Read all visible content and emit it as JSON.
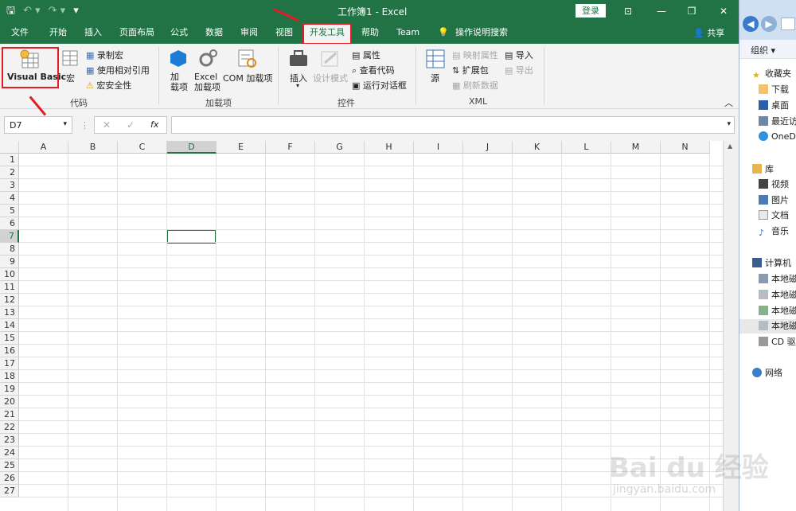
{
  "titlebar": {
    "title": "工作簿1  -  Excel",
    "login": "登录"
  },
  "tabs": [
    {
      "label": "文件"
    },
    {
      "label": "开始"
    },
    {
      "label": "插入"
    },
    {
      "label": "页面布局"
    },
    {
      "label": "公式"
    },
    {
      "label": "数据"
    },
    {
      "label": "审阅"
    },
    {
      "label": "视图"
    },
    {
      "label": "开发工具"
    },
    {
      "label": "帮助"
    },
    {
      "label": "Team"
    },
    {
      "label": "操作说明搜索"
    }
  ],
  "share": "共享",
  "ribbon": {
    "code": {
      "visual_basic": "Visual Basic",
      "macros": "宏",
      "record_macro": "录制宏",
      "relative_refs": "使用相对引用",
      "macro_security": "宏安全性",
      "group": "代码"
    },
    "addins": {
      "addins": "加\n载项",
      "excel_addins": "Excel\n加载项",
      "com_addins": "COM 加载项",
      "group": "加载项"
    },
    "controls": {
      "insert": "插入",
      "design_mode": "设计模式",
      "properties": "属性",
      "view_code": "查看代码",
      "run_dialog": "运行对话框",
      "group": "控件"
    },
    "xml": {
      "source": "源",
      "map_props": "映射属性",
      "expansion": "扩展包",
      "refresh": "刷新数据",
      "import": "导入",
      "export": "导出",
      "group": "XML"
    }
  },
  "formula": {
    "namebox": "D7",
    "fx": "fx",
    "value": ""
  },
  "columns": [
    "A",
    "B",
    "C",
    "D",
    "E",
    "F",
    "G",
    "H",
    "I",
    "J",
    "K",
    "L",
    "M",
    "N"
  ],
  "rows": [
    "1",
    "2",
    "3",
    "4",
    "5",
    "6",
    "7",
    "8",
    "9",
    "10",
    "11",
    "12",
    "13",
    "14",
    "15",
    "16",
    "17",
    "18",
    "19",
    "20",
    "21",
    "22",
    "23",
    "24",
    "25",
    "26",
    "27"
  ],
  "selected": {
    "column": "D",
    "row": "7"
  },
  "explorer": {
    "organize": "组织 ▾",
    "favorites": "收藏夹",
    "downloads": "下载",
    "desktop": "桌面",
    "recent": "最近访",
    "onedrive": "OneD",
    "libraries": "库",
    "videos": "视频",
    "pictures": "图片",
    "documents": "文档",
    "music": "音乐",
    "computer": "计算机",
    "disk1": "本地磁",
    "disk2": "本地磁",
    "disk3": "本地磁",
    "disk4": "本地磁",
    "cd": "CD 驱",
    "network": "网络"
  },
  "watermark": {
    "brand": "Bai du 经验",
    "url": "jingyan.baidu.com"
  }
}
